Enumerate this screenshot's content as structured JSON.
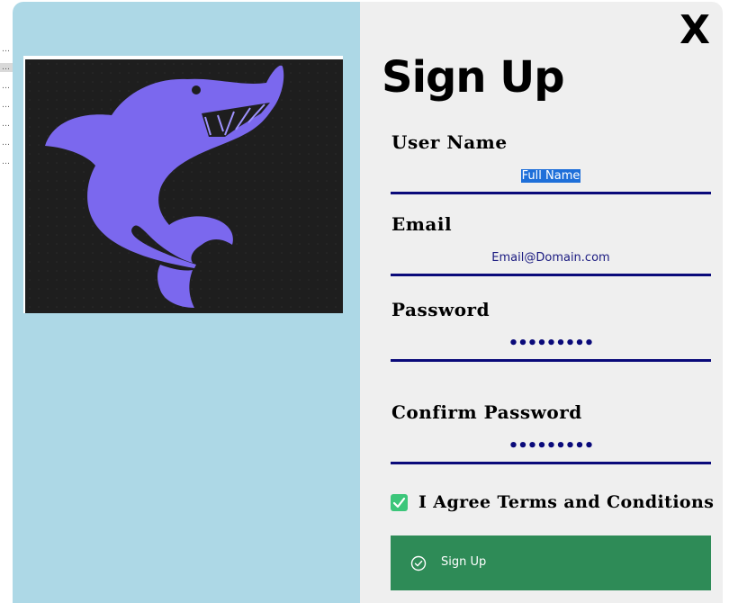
{
  "form": {
    "title": "Sign Up",
    "close_label": "X",
    "fields": [
      {
        "label": "User Name",
        "value": "Full Name",
        "selected": true
      },
      {
        "label": "Email",
        "value": "Email@Domain.com"
      },
      {
        "label": "Password",
        "value": "•••••••••"
      },
      {
        "label": "Confirm Password",
        "value": "•••••••••"
      }
    ],
    "agree": {
      "label": "I Agree Terms and Conditions",
      "checked": true
    },
    "submit_label": "Sign Up"
  },
  "colors": {
    "left_panel": "#add8e6",
    "right_panel": "#efefef",
    "accent_underline": "#0a0a7a",
    "submit_button": "#2e8b57",
    "checkbox": "#3cc67a",
    "illustration_bg": "#1e1e1e",
    "illustration_shark": "#7b68ee"
  },
  "icons": {
    "close": "close-icon",
    "checkbox": "checkmark-icon",
    "submit": "check-circle-icon",
    "illustration": "shark-illustration"
  }
}
